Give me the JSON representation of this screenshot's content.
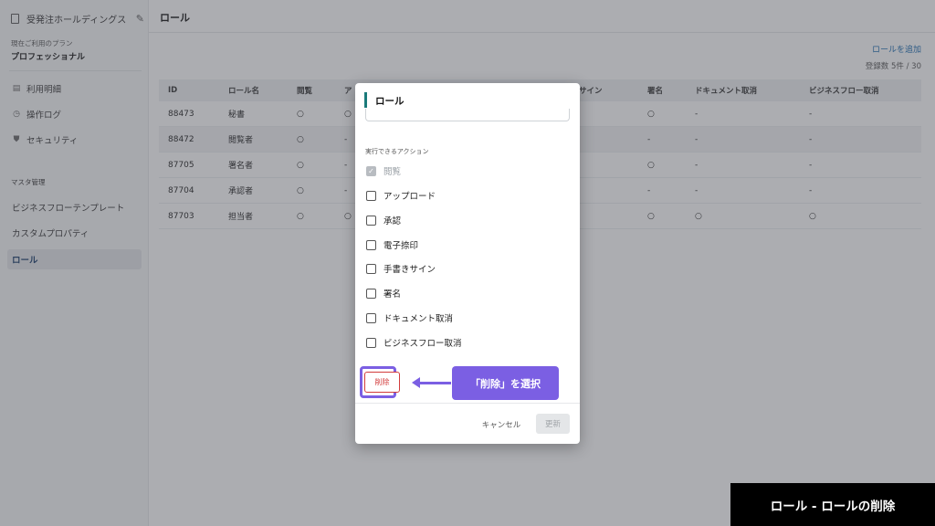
{
  "sidebar": {
    "company": "受発注ホールディングス",
    "plan_label": "現在ご利用のプラン",
    "plan_name": "プロフェッショナル",
    "menu": [
      {
        "label": "利用明細",
        "icon": "receipt-icon"
      },
      {
        "label": "操作ログ",
        "icon": "history-icon"
      },
      {
        "label": "セキュリティ",
        "icon": "shield-icon"
      }
    ],
    "section_title": "マスタ管理",
    "master_items": [
      {
        "label": "ビジネスフローテンプレート"
      },
      {
        "label": "カスタムプロパティ"
      },
      {
        "label": "ロール"
      }
    ]
  },
  "header": {
    "title": "ロール",
    "add_link": "ロールを追加",
    "count": "登録数 5件 / 30"
  },
  "table": {
    "columns": [
      "ID",
      "ロール名",
      "閲覧",
      "ア",
      "サイン",
      "署名",
      "ドキュメント取消",
      "ビジネスフロー取消"
    ],
    "rows": [
      [
        "88473",
        "秘書",
        "○",
        "○",
        "",
        "○",
        "-",
        "-"
      ],
      [
        "88472",
        "閲覧者",
        "○",
        "-",
        "",
        "-",
        "-",
        "-"
      ],
      [
        "87705",
        "署名者",
        "○",
        "-",
        "",
        "○",
        "-",
        "-"
      ],
      [
        "87704",
        "承認者",
        "○",
        "-",
        "",
        "-",
        "-",
        "-"
      ],
      [
        "87703",
        "担当者",
        "○",
        "○",
        "",
        "○",
        "○",
        "○"
      ]
    ]
  },
  "modal": {
    "title": "ロール",
    "actions_label": "実行できるアクション",
    "actions": [
      {
        "label": "閲覧",
        "checked": true,
        "disabled": true
      },
      {
        "label": "アップロード",
        "checked": false
      },
      {
        "label": "承認",
        "checked": false
      },
      {
        "label": "電子捺印",
        "checked": false
      },
      {
        "label": "手書きサイン",
        "checked": false
      },
      {
        "label": "署名",
        "checked": false
      },
      {
        "label": "ドキュメント取消",
        "checked": false
      },
      {
        "label": "ビジネスフロー取消",
        "checked": false
      }
    ],
    "delete_label": "削除",
    "cancel_label": "キャンセル",
    "update_label": "更新"
  },
  "annotation": {
    "callout": "「削除」を選択"
  },
  "caption": "ロール - ロールの削除",
  "colors": {
    "accent": "#7b5fe3",
    "delete": "#d23b3b",
    "title_bar": "#1a7a7a",
    "link": "#1a6bb0"
  }
}
